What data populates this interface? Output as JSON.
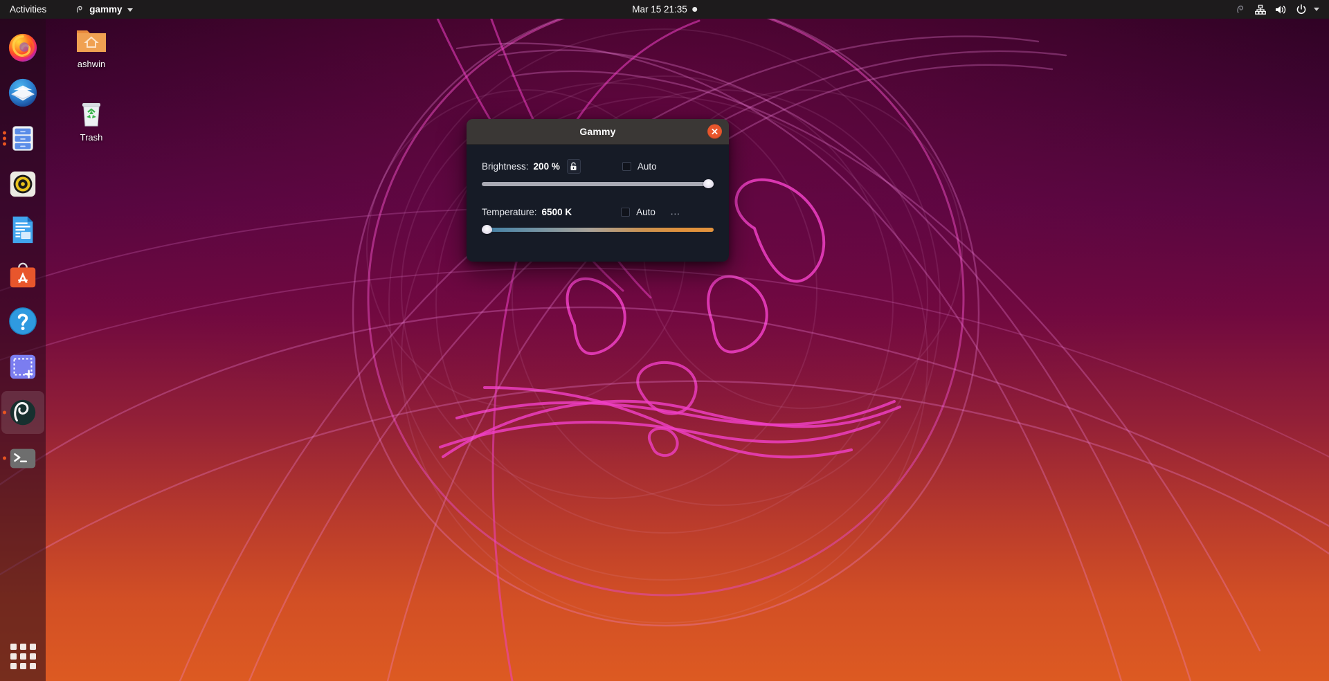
{
  "topbar": {
    "activities": "Activities",
    "app_menu": {
      "name": "gammy",
      "icon": "gammy-app-icon",
      "caret": "chevron-down-icon"
    },
    "clock": {
      "text": "Mar 15  21:35",
      "notification_indicator": "notification-dot"
    },
    "system_icons": [
      "gammy-tray-icon",
      "network-wired-icon",
      "volume-icon",
      "power-icon",
      "chevron-down-icon"
    ]
  },
  "dock": {
    "items": [
      {
        "name": "firefox",
        "label": "Firefox",
        "running": false,
        "active": false
      },
      {
        "name": "thunderbird",
        "label": "Thunderbird Mail",
        "running": false,
        "active": false
      },
      {
        "name": "files",
        "label": "Files",
        "running": true,
        "windows": 3,
        "active": false
      },
      {
        "name": "rhythmbox",
        "label": "Rhythmbox",
        "running": false,
        "active": false
      },
      {
        "name": "libreoffice-writer",
        "label": "LibreOffice Writer",
        "running": false,
        "active": false
      },
      {
        "name": "ubuntu-software",
        "label": "Ubuntu Software",
        "running": false,
        "active": false
      },
      {
        "name": "help",
        "label": "Help",
        "running": false,
        "active": false
      },
      {
        "name": "screenshot",
        "label": "Screenshot",
        "running": false,
        "active": false
      },
      {
        "name": "gammy",
        "label": "Gammy",
        "running": true,
        "windows": 1,
        "active": true
      },
      {
        "name": "terminal",
        "label": "Terminal",
        "running": true,
        "windows": 1,
        "active": false
      }
    ],
    "app_grid": "show-applications"
  },
  "desktop": {
    "icons": [
      {
        "name": "home-folder",
        "label": "ashwin",
        "icon": "folder-home-icon"
      },
      {
        "name": "trash",
        "label": "Trash",
        "icon": "trash-icon"
      }
    ]
  },
  "gammy": {
    "title": "Gammy",
    "close_label": "×",
    "brightness": {
      "label": "Brightness:",
      "value": "200 %",
      "percent": 100,
      "lock_icon": "unlocked-padlock-icon",
      "auto_label": "Auto",
      "auto_checked": false
    },
    "temperature": {
      "label": "Temperature:",
      "value": "6500 K",
      "percent": 0,
      "auto_label": "Auto",
      "auto_checked": false,
      "more_label": "..."
    }
  },
  "colors": {
    "accent": "#e95420",
    "topbar_bg": "#1d1b1c",
    "window_bg": "#161b26",
    "titlebar_bg": "#3a3735",
    "close_btn": "#e8562c"
  }
}
